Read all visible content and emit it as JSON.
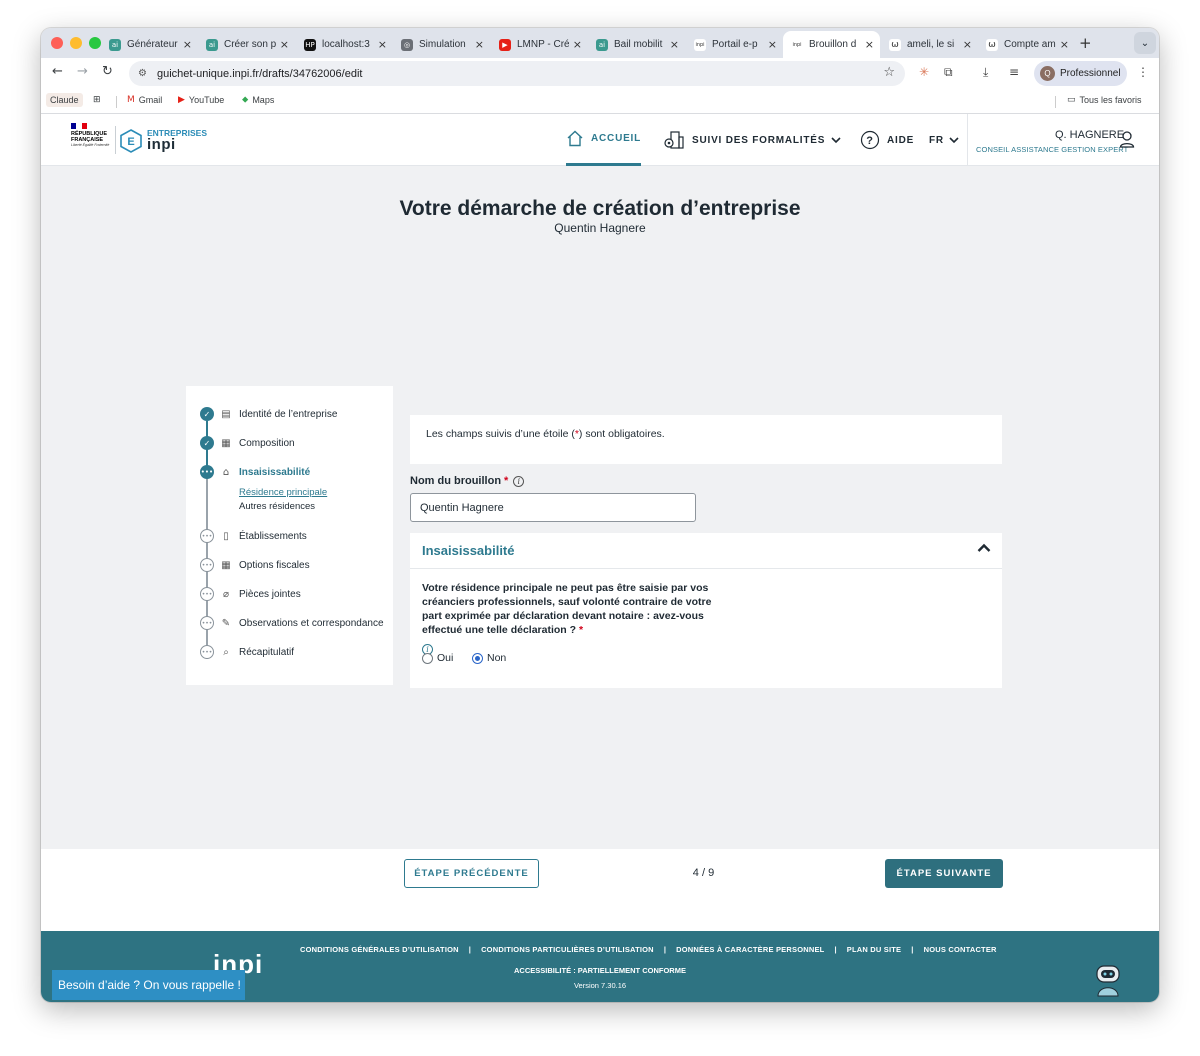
{
  "browser": {
    "tabs": [
      {
        "title": "Générateur",
        "fav_color": "#3b9a8f",
        "fav_text": "ai"
      },
      {
        "title": "Créer son p",
        "fav_color": "#3b9a8f",
        "fav_text": "ai"
      },
      {
        "title": "localhost:3",
        "fav_color": "#111111",
        "fav_text": "HP"
      },
      {
        "title": "Simulation",
        "fav_color": "#6b6f76",
        "fav_text": "◎"
      },
      {
        "title": "LMNP - Cré",
        "fav_color": "#e62117",
        "fav_text": "▶"
      },
      {
        "title": "Bail mobilit",
        "fav_color": "#3b9a8f",
        "fav_text": "ai"
      },
      {
        "title": "Portail e-p",
        "fav_color": "#ffffff",
        "fav_text": "inpi"
      },
      {
        "title": "Brouillon d",
        "fav_color": "#ffffff",
        "fav_text": "inpi"
      },
      {
        "title": "ameli, le si",
        "fav_color": "#ffffff",
        "fav_text": "ω"
      },
      {
        "title": "Compte am",
        "fav_color": "#ffffff",
        "fav_text": "ω"
      }
    ],
    "active_tab_index": 7,
    "new_tab_label": "+",
    "url": "guichet-unique.inpi.fr/drafts/34762006/edit",
    "profile_label": "Professionnel",
    "profile_initial": "Q",
    "bookmarks": {
      "claude": "Claude",
      "gmail": "Gmail",
      "youtube": "YouTube",
      "maps": "Maps",
      "all": "Tous les favoris"
    }
  },
  "header": {
    "rf_text": "RÉPUBLIQUE FRANÇAISE",
    "rf_motto": "Liberté Égalité Fraternité",
    "brand_top": "ENTREPRISES",
    "brand_word": "inpi",
    "nav": {
      "home": "ACCUEIL",
      "tracking": "SUIVI DES FORMALITÉS",
      "help": "AIDE",
      "lang": "FR"
    },
    "user_name": "Q. HAGNERE",
    "user_company": "CONSEIL ASSISTANCE GESTION EXPERT"
  },
  "page": {
    "title": "Votre démarche de création d’entreprise",
    "subtitle": "Quentin Hagnere"
  },
  "steps": [
    {
      "label": "Identité de l’entreprise",
      "status": "done"
    },
    {
      "label": "Composition",
      "status": "done"
    },
    {
      "label": "Insaisissabilité",
      "status": "current"
    },
    {
      "label": "Établissements",
      "status": "todo"
    },
    {
      "label": "Options fiscales",
      "status": "todo"
    },
    {
      "label": "Pièces jointes",
      "status": "todo"
    },
    {
      "label": "Observations et correspondance",
      "status": "todo"
    },
    {
      "label": "Récapitulatif",
      "status": "todo"
    }
  ],
  "substeps": {
    "active": "Résidence principale",
    "other": "Autres résidences"
  },
  "form": {
    "notice_before": "Les champs suivis d’une étoile (",
    "notice_star": "*",
    "notice_after": ") sont obligatoires.",
    "name_label": "Nom du brouillon",
    "required_mark": "*",
    "name_value": "Quentin Hagnere",
    "section_title": "Insaisissabilité",
    "question": "Votre résidence principale ne peut pas être saisie par vos créanciers professionnels, sauf volonté contraire de votre part exprimée par déclaration devant notaire : avez-vous effectué une telle déclaration ?",
    "option_yes": "Oui",
    "option_no": "Non",
    "selected": "Non"
  },
  "pager": {
    "prev": "ÉTAPE PRÉCÉDENTE",
    "position": "4 / 9",
    "next": "ÉTAPE SUIVANTE"
  },
  "footer": {
    "logo": "inpi",
    "links": [
      "CONDITIONS GÉNÉRALES D’UTILISATION",
      "CONDITIONS PARTICULIÈRES D’UTILISATION",
      "DONNÉES À CARACTÈRE PERSONNEL",
      "PLAN DU SITE",
      "NOUS CONTACTER"
    ],
    "accessibility": "ACCESSIBILITÉ : PARTIELLEMENT CONFORME",
    "version": "Version 7.30.16",
    "help_button": "Besoin d’aide ? On vous rappelle !"
  },
  "colors": {
    "accent": "#2e7a8f",
    "footer_bg": "#2e7382",
    "help_bg": "#2e8fc4",
    "required": "#d0021b"
  }
}
